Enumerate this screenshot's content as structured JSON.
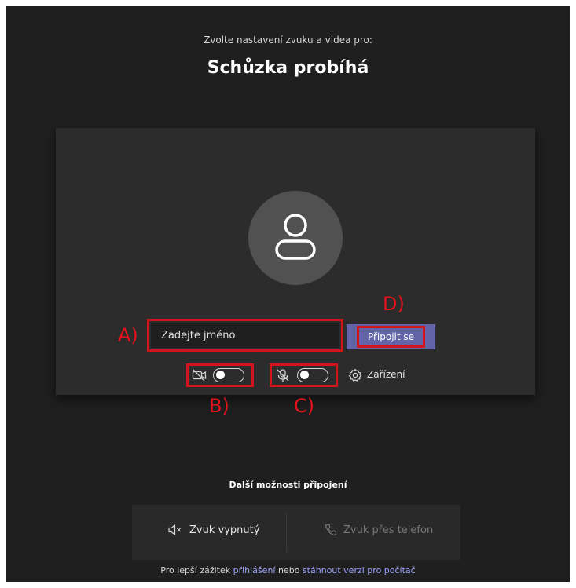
{
  "header": {
    "subtitle": "Zvolte nastavení zvuku a videa pro:",
    "title": "Schůzka probíhá"
  },
  "name_input": {
    "value": "",
    "placeholder": "Zadejte jméno"
  },
  "join_button": {
    "label": "Připojit se"
  },
  "video_toggle": {
    "on": false,
    "icon": "camera-off-icon"
  },
  "mic_toggle": {
    "on": false,
    "icon": "microphone-off-icon"
  },
  "devices": {
    "label": "Zařízení",
    "icon": "gear-icon"
  },
  "annotations": {
    "a": "A)",
    "b": "B)",
    "c": "C)",
    "d": "D)",
    "color": "#d4141c"
  },
  "more_options": {
    "title": "Další možnosti připojení",
    "audio_off": {
      "label": "Zvuk vypnutý",
      "icon": "speaker-mute-icon"
    },
    "phone_audio": {
      "label": "Zvuk přes telefon",
      "icon": "phone-icon"
    }
  },
  "footer": {
    "prefix": "Pro lepší zážitek",
    "signin_link": "přihlášení",
    "middle": "nebo",
    "download_link": "stáhnout verzi pro počítač"
  },
  "colors": {
    "background": "#1f1f1f",
    "card": "#2d2c2c",
    "accent": "#6264a7",
    "link": "#9ea2ff"
  }
}
